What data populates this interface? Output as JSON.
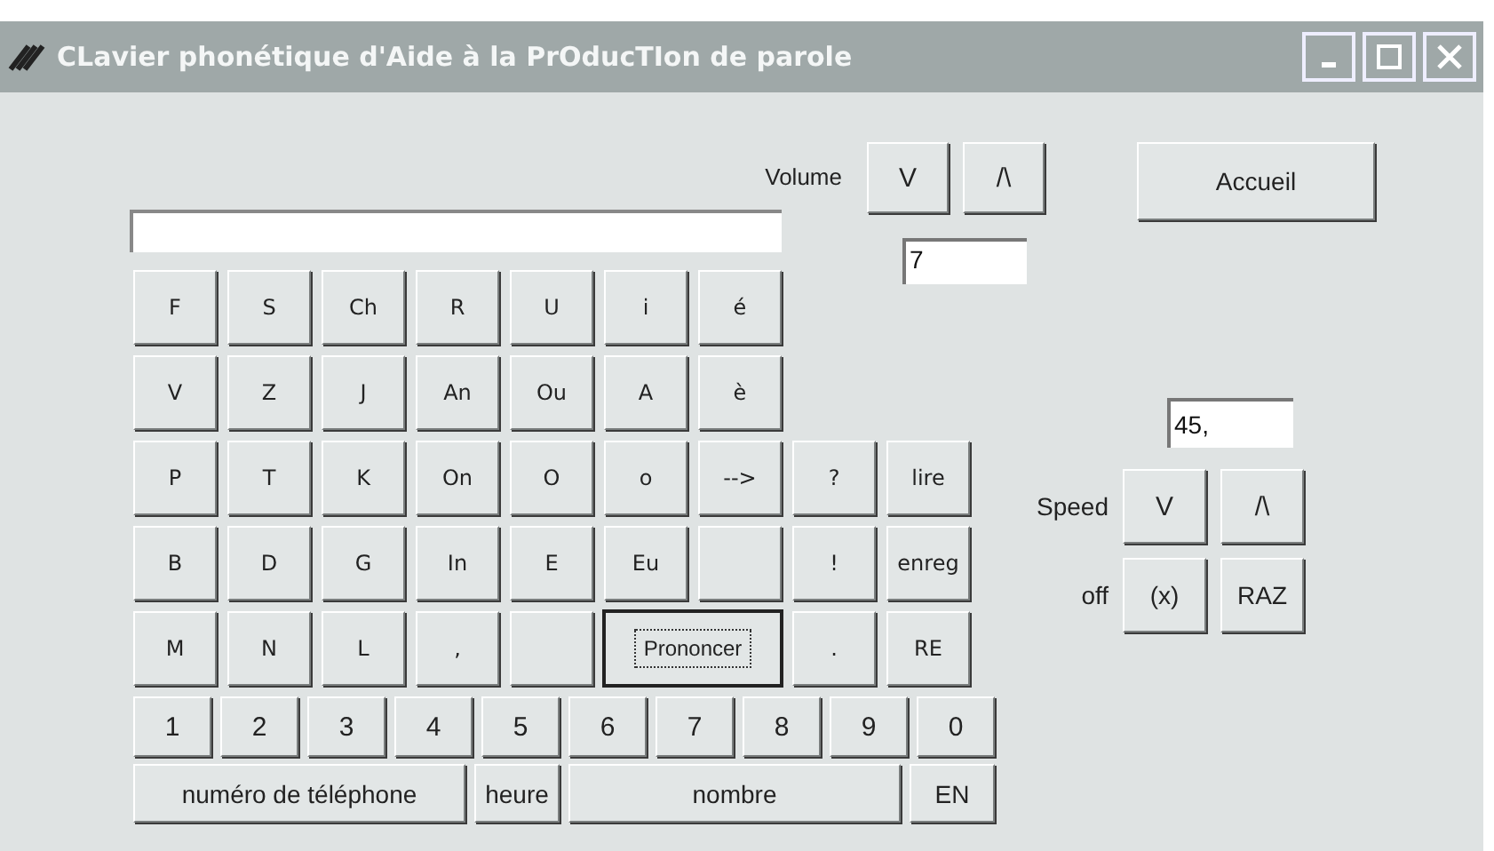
{
  "window": {
    "title": "CLavier phonétique d'Aide à la PrOducTIon de parole"
  },
  "volume": {
    "label": "Volume",
    "buttons": [
      "V",
      "/\\"
    ],
    "value": "7"
  },
  "home_button": "Accueil",
  "speed": {
    "value": "45,",
    "label": "Speed",
    "buttons": [
      "V",
      "/\\"
    ],
    "off_label": "off",
    "off_buttons": [
      "(x)",
      "RAZ"
    ]
  },
  "keyboard": {
    "lines": [
      {
        "keys": [
          {
            "kind": "key",
            "label": "F",
            "focused": false
          },
          {
            "kind": "key",
            "label": "S",
            "focused": false
          },
          {
            "kind": "key",
            "label": "Ch",
            "focused": false
          },
          {
            "kind": "key",
            "label": "R",
            "focused": false
          },
          {
            "kind": "key",
            "label": "U",
            "focused": false
          },
          {
            "kind": "key",
            "label": "i",
            "focused": false
          },
          {
            "kind": "key",
            "label": "é",
            "focused": false
          }
        ]
      },
      {
        "keys": [
          {
            "kind": "key",
            "label": "V",
            "focused": false
          },
          {
            "kind": "key",
            "label": "Z",
            "focused": false
          },
          {
            "kind": "key",
            "label": "J",
            "focused": false
          },
          {
            "kind": "key",
            "label": "An",
            "focused": false
          },
          {
            "kind": "key",
            "label": "Ou",
            "focused": false
          },
          {
            "kind": "key",
            "label": "A",
            "focused": false
          },
          {
            "kind": "key",
            "label": "è",
            "focused": false
          }
        ]
      },
      {
        "keys": [
          {
            "kind": "key",
            "label": "P",
            "focused": false
          },
          {
            "kind": "key",
            "label": "T",
            "focused": false
          },
          {
            "kind": "key",
            "label": "K",
            "focused": false
          },
          {
            "kind": "key",
            "label": "On",
            "focused": false
          },
          {
            "kind": "key",
            "label": "O",
            "focused": false
          },
          {
            "kind": "key",
            "label": "o",
            "focused": false
          },
          {
            "kind": "key",
            "label": "-->",
            "focused": false
          },
          {
            "kind": "key",
            "label": "?",
            "focused": false
          },
          {
            "kind": "key",
            "label": "lire",
            "focused": false
          }
        ]
      },
      {
        "keys": [
          {
            "kind": "key",
            "label": "B",
            "focused": false
          },
          {
            "kind": "key",
            "label": "D",
            "focused": false
          },
          {
            "kind": "key",
            "label": "G",
            "focused": false
          },
          {
            "kind": "key",
            "label": "In",
            "focused": false
          },
          {
            "kind": "key",
            "label": "E",
            "focused": false
          },
          {
            "kind": "key",
            "label": "Eu",
            "focused": false
          },
          {
            "kind": "blank",
            "focused": false
          },
          {
            "kind": "key",
            "label": "!",
            "focused": false
          },
          {
            "kind": "key",
            "label": "enreg",
            "focused": false
          }
        ]
      },
      {
        "keys": [
          {
            "kind": "key",
            "label": "M",
            "focused": false
          },
          {
            "kind": "key",
            "label": "N",
            "focused": false
          },
          {
            "kind": "key",
            "label": "L",
            "focused": false
          },
          {
            "kind": "key",
            "label": ",",
            "focused": false
          },
          {
            "kind": "blank",
            "focused": false
          },
          {
            "kind": "double",
            "label": "Prononcer",
            "focused": true
          },
          {
            "kind": "key",
            "label": ".",
            "focused": false
          },
          {
            "kind": "key",
            "label": "RE",
            "focused": false
          }
        ]
      }
    ],
    "digits": [
      "1",
      "2",
      "3",
      "4",
      "5",
      "6",
      "7",
      "8",
      "9",
      "0"
    ],
    "bottom": [
      {
        "kind": "wide",
        "label": "numéro de téléphone"
      },
      {
        "kind": "narrow",
        "label": "heure"
      },
      {
        "kind": "wide",
        "label": "nombre"
      },
      {
        "kind": "narrow",
        "label": "EN"
      }
    ]
  }
}
